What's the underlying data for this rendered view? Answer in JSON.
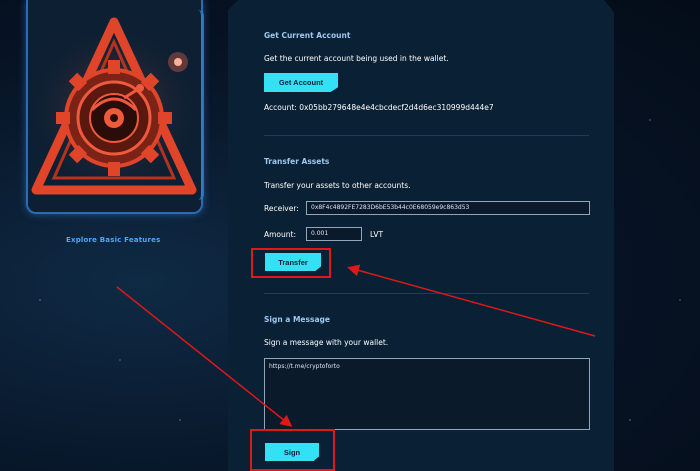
{
  "sidebar": {
    "explore_label": "Explore Basic Features"
  },
  "get_account": {
    "title": "Get Current Account",
    "description": "Get the current account being used in the wallet.",
    "button_label": "Get  Account",
    "account_text": "Account: 0x05bb279648e4e4cbcdecf2d4d6ec310999d444e7"
  },
  "transfer": {
    "title": "Transfer Assets",
    "description": "Transfer your assets to other accounts.",
    "receiver_label": "Receiver:",
    "receiver_value": "0x8F4c4892FE7283D6bE53b44c0E68059e9c863d53",
    "amount_label": "Amount:",
    "amount_value": "0.001",
    "unit": "LVT",
    "button_label": "Transfer"
  },
  "sign": {
    "title": "Sign a Message",
    "description": "Sign a message with your wallet.",
    "message_value": "https://t.me/cryptoforto",
    "button_label": "Sign"
  },
  "colors": {
    "accent": "#34e0f4",
    "panel": "#0a2035",
    "highlight": "#e01818",
    "emblem": "#e0452a"
  },
  "icons": [
    "gear-emblem-icon"
  ]
}
